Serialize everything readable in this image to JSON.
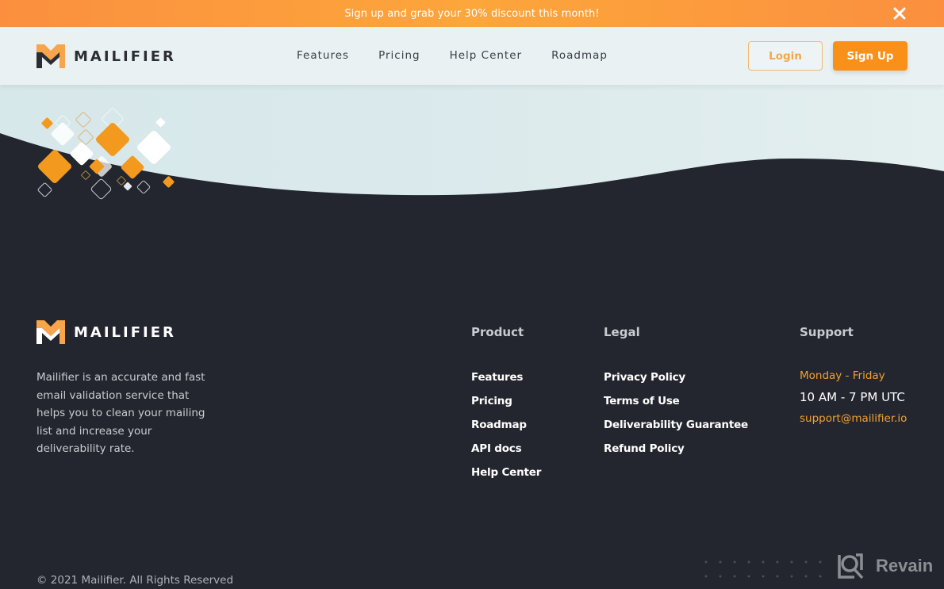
{
  "promo": {
    "text": "Sign up and grab your 30% discount this month!",
    "close_icon": "close-icon"
  },
  "brand": {
    "name": "MAILIFIER",
    "logo_icon": "mailifier-m-logo",
    "accent_color": "#f8901a",
    "dark_color": "#23262e"
  },
  "nav": {
    "links": [
      {
        "label": "Features"
      },
      {
        "label": "Pricing"
      },
      {
        "label": "Help Center"
      },
      {
        "label": "Roadmap"
      }
    ],
    "login_label": "Login",
    "signup_label": "Sign Up"
  },
  "footer": {
    "description": "Mailifier is an accurate and fast email validation service that helps you to clean your mailing list and increase your deliverability rate.",
    "columns": {
      "product": {
        "title": "Product",
        "links": [
          "Features",
          "Pricing",
          "Roadmap",
          "API docs",
          "Help Center"
        ]
      },
      "legal": {
        "title": "Legal",
        "links": [
          "Privacy Policy",
          "Terms of Use",
          "Deliverability Guarantee",
          "Refund Policy"
        ]
      },
      "support": {
        "title": "Support",
        "days": "Monday - Friday",
        "hours": "10 AM - 7 PM UTC",
        "email": "support@mailifier.io"
      }
    },
    "copyright": "© 2021 Mailifier. All Rights Reserved"
  },
  "watermark": {
    "label": "Revain",
    "icon": "revain-logo-icon"
  }
}
